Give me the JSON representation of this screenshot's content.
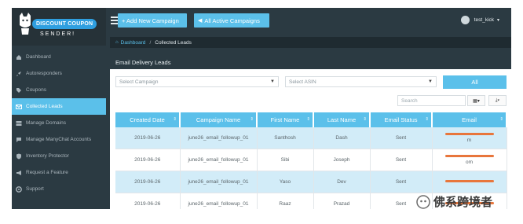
{
  "logo": {
    "badge": "DISCOUNT COUPON",
    "subtitle": "SENDER!"
  },
  "sidebar": {
    "items": [
      {
        "label": "Dashboard",
        "icon": "home-icon",
        "active": false
      },
      {
        "label": "Autoresponders",
        "icon": "rocket-icon",
        "active": false
      },
      {
        "label": "Coupons",
        "icon": "tag-icon",
        "active": false
      },
      {
        "label": "Collected Leads",
        "icon": "envelope-icon",
        "active": true
      },
      {
        "label": "Manage Domains",
        "icon": "server-icon",
        "active": false
      },
      {
        "label": "Manage ManyChat Accounts",
        "icon": "chat-icon",
        "active": false
      },
      {
        "label": "Inventory Protector",
        "icon": "shield-icon",
        "active": false
      },
      {
        "label": "Request a Feature",
        "icon": "megaphone-icon",
        "active": false
      },
      {
        "label": "Support",
        "icon": "lifebuoy-icon",
        "active": false
      }
    ]
  },
  "topbar": {
    "add_campaign": "+ Add New Campaign",
    "all_active": "All Active Campaigns",
    "user": "test_kick"
  },
  "breadcrumb": {
    "home": "Dashboard",
    "current": "Collected Leads"
  },
  "panel": {
    "title": "Email Delivery Leads",
    "select_campaign": "Select Campaign",
    "select_asin": "Select ASIN",
    "all_button": "All",
    "search_placeholder": "Search"
  },
  "table": {
    "columns": [
      "Created Date",
      "Campaign Name",
      "First Name",
      "Last Name",
      "Email Status",
      "Email"
    ],
    "rows": [
      {
        "date": "2019-06-26",
        "campaign": "june26_email_followup_01",
        "first": "Santhosh",
        "last": "Dash",
        "status": "Sent",
        "email_tail": "m"
      },
      {
        "date": "2019-06-26",
        "campaign": "june26_email_followup_01",
        "first": "Sibi",
        "last": "Joseph",
        "status": "Sent",
        "email_tail": "om"
      },
      {
        "date": "2019-06-26",
        "campaign": "june26_email_followup_01",
        "first": "Yaso",
        "last": "Dev",
        "status": "Sent",
        "email_tail": ""
      },
      {
        "date": "2019-06-26",
        "campaign": "june26_email_followup_01",
        "first": "Raaz",
        "last": "Prazad",
        "status": "Sent",
        "email_tail": ""
      }
    ]
  },
  "watermark": {
    "text": "佛系跨境者"
  },
  "colors": {
    "accent": "#5bc0ea",
    "dark": "#2b3a42",
    "row_highlight": "#d2ecf8",
    "redaction": "#e8763c"
  }
}
